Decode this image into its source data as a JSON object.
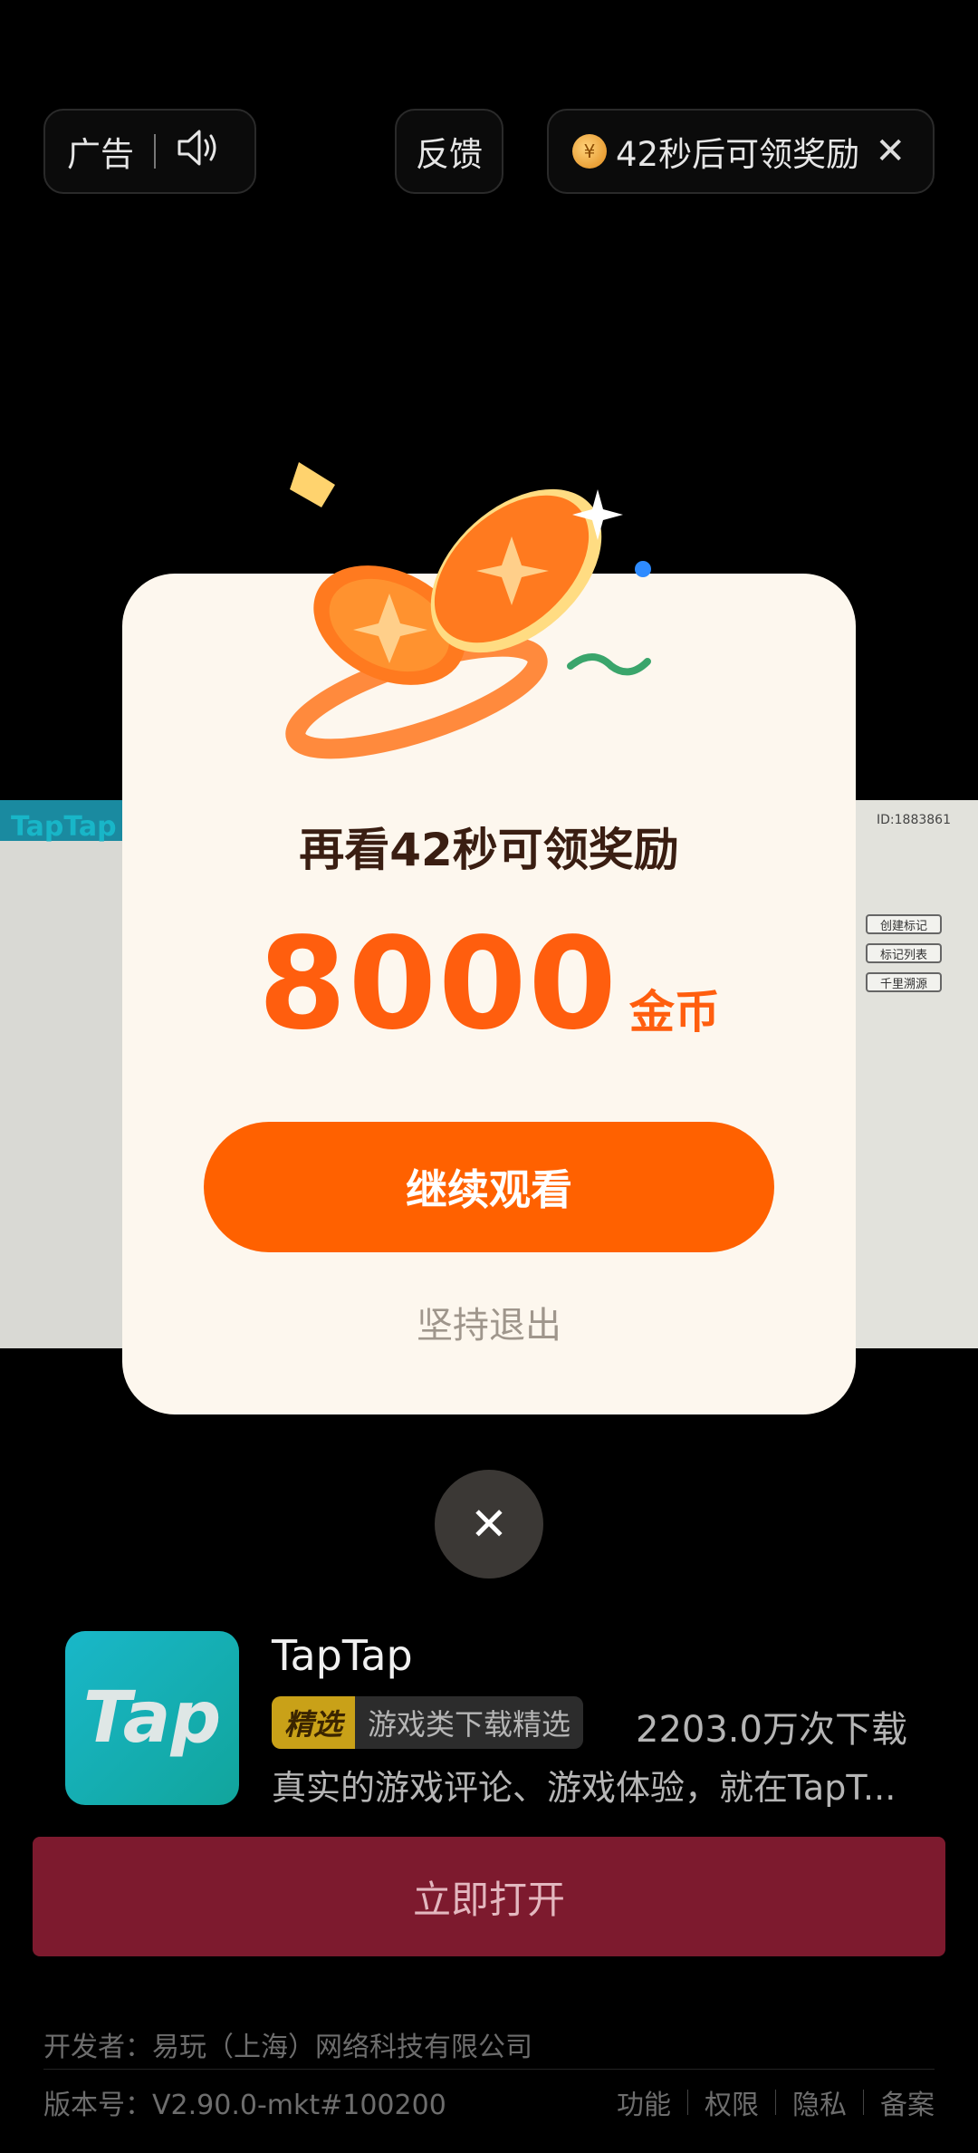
{
  "top_bar": {
    "ad_label": "广告",
    "feedback_label": "反馈",
    "coin_symbol": "¥",
    "reward_countdown": "42秒后可领奖励",
    "close_symbol": "✕"
  },
  "video": {
    "brand": "TapTap",
    "id_text": "ID:1883861",
    "tags": [
      "创建标记",
      "标记列表",
      "千里溯源"
    ]
  },
  "modal": {
    "title": "再看42秒可领奖励",
    "amount": "8000",
    "unit": "金币",
    "continue_label": "继续观看",
    "exit_label": "坚持退出"
  },
  "dismiss_symbol": "✕",
  "app": {
    "icon_text": "Tap",
    "name": "TapTap",
    "badge_tag": "精选",
    "badge_text": "游戏类下载精选",
    "downloads": "2203.0万次下载",
    "description": "真实的游戏评论、游戏体验，就在TapT..."
  },
  "open_label": "立即打开",
  "footer": {
    "developer": "开发者：易玩（上海）网络科技有限公司",
    "version": "版本号：V2.90.0-mkt#100200",
    "links": [
      "功能",
      "权限",
      "隐私",
      "备案"
    ]
  },
  "colors": {
    "accent": "#ff6100",
    "open_button": "#7d1a2e",
    "modal_bg": "#fdf7ee"
  }
}
